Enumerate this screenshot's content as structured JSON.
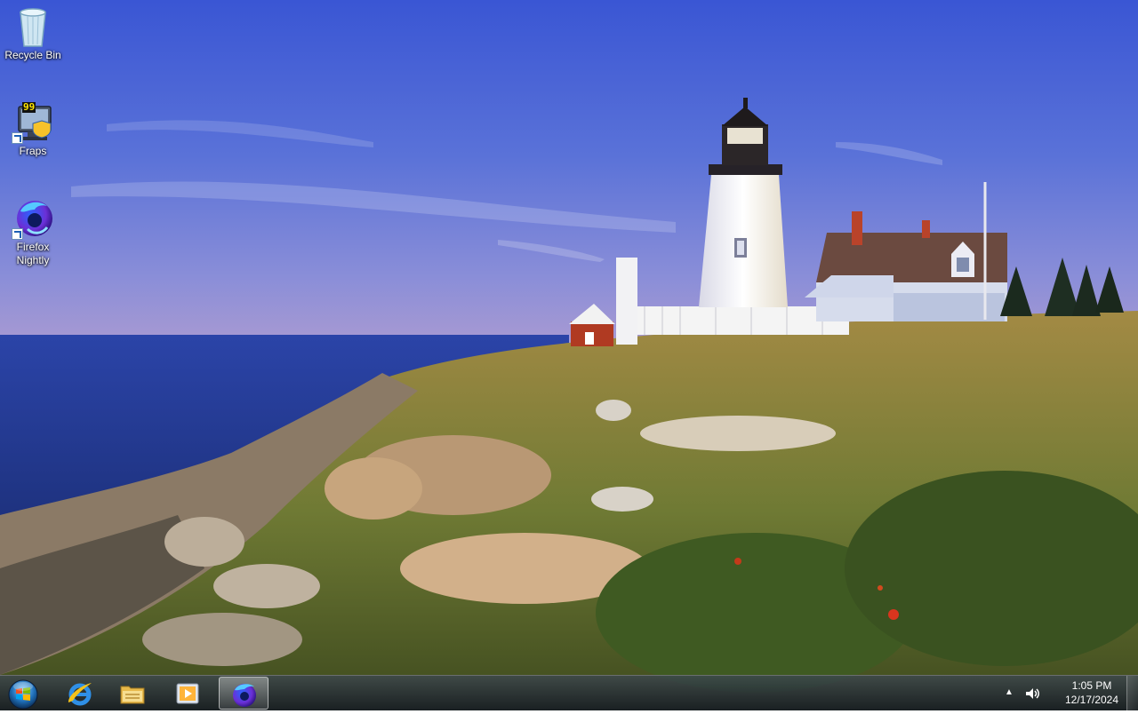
{
  "desktop": {
    "icons": [
      {
        "label": "Recycle Bin",
        "icon": "recycle-bin-icon"
      },
      {
        "label": "Fraps",
        "icon": "fraps-icon",
        "badge": "99"
      },
      {
        "label": "Firefox Nightly",
        "icon": "firefox-nightly-icon"
      }
    ]
  },
  "taskbar": {
    "start": "start-orb-icon",
    "pinned": [
      {
        "name": "Internet Explorer",
        "icon": "internet-explorer-icon"
      },
      {
        "name": "Windows Explorer",
        "icon": "folder-icon"
      },
      {
        "name": "Windows Media Player",
        "icon": "media-player-icon"
      },
      {
        "name": "Firefox Nightly",
        "icon": "firefox-nightly-icon"
      }
    ],
    "tray": {
      "time": "1:05 PM",
      "date": "12/17/2024"
    }
  },
  "colors": {
    "sky_top": "#3f5fd6",
    "sea": "#2a3f9a",
    "taskbar": "#1e2633"
  }
}
